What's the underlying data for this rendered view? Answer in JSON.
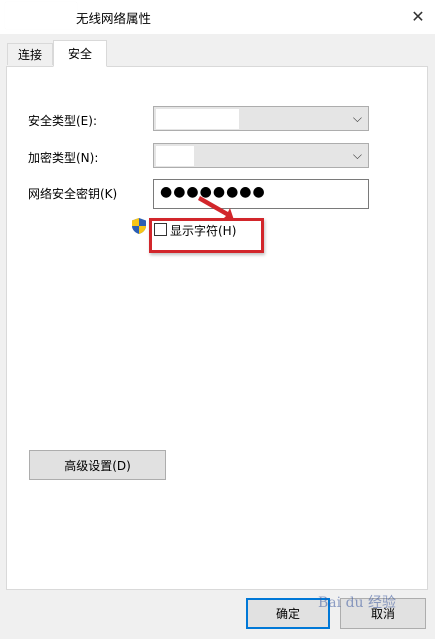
{
  "window": {
    "title": "无线网络属性",
    "close_glyph": "✕"
  },
  "tabs": [
    {
      "label": "连接",
      "active": false
    },
    {
      "label": "安全",
      "active": true
    }
  ],
  "security": {
    "type_label": "安全类型(E):",
    "encryption_label": "加密类型(N):",
    "key_label": "网络安全密钥(K)",
    "key_value": "●●●●●●●●",
    "show_chars_label": "显示字符(H)",
    "show_chars_checked": false,
    "dropdown_arrow": "⌵"
  },
  "buttons": {
    "advanced": "高级设置(D)",
    "ok": "确定",
    "cancel": "取消"
  },
  "watermark": "Bai du 经验",
  "colors": {
    "annotation": "#d2262b",
    "focus": "#0078d7",
    "shield_blue": "#2b5fb4",
    "shield_yellow": "#f5c518"
  }
}
